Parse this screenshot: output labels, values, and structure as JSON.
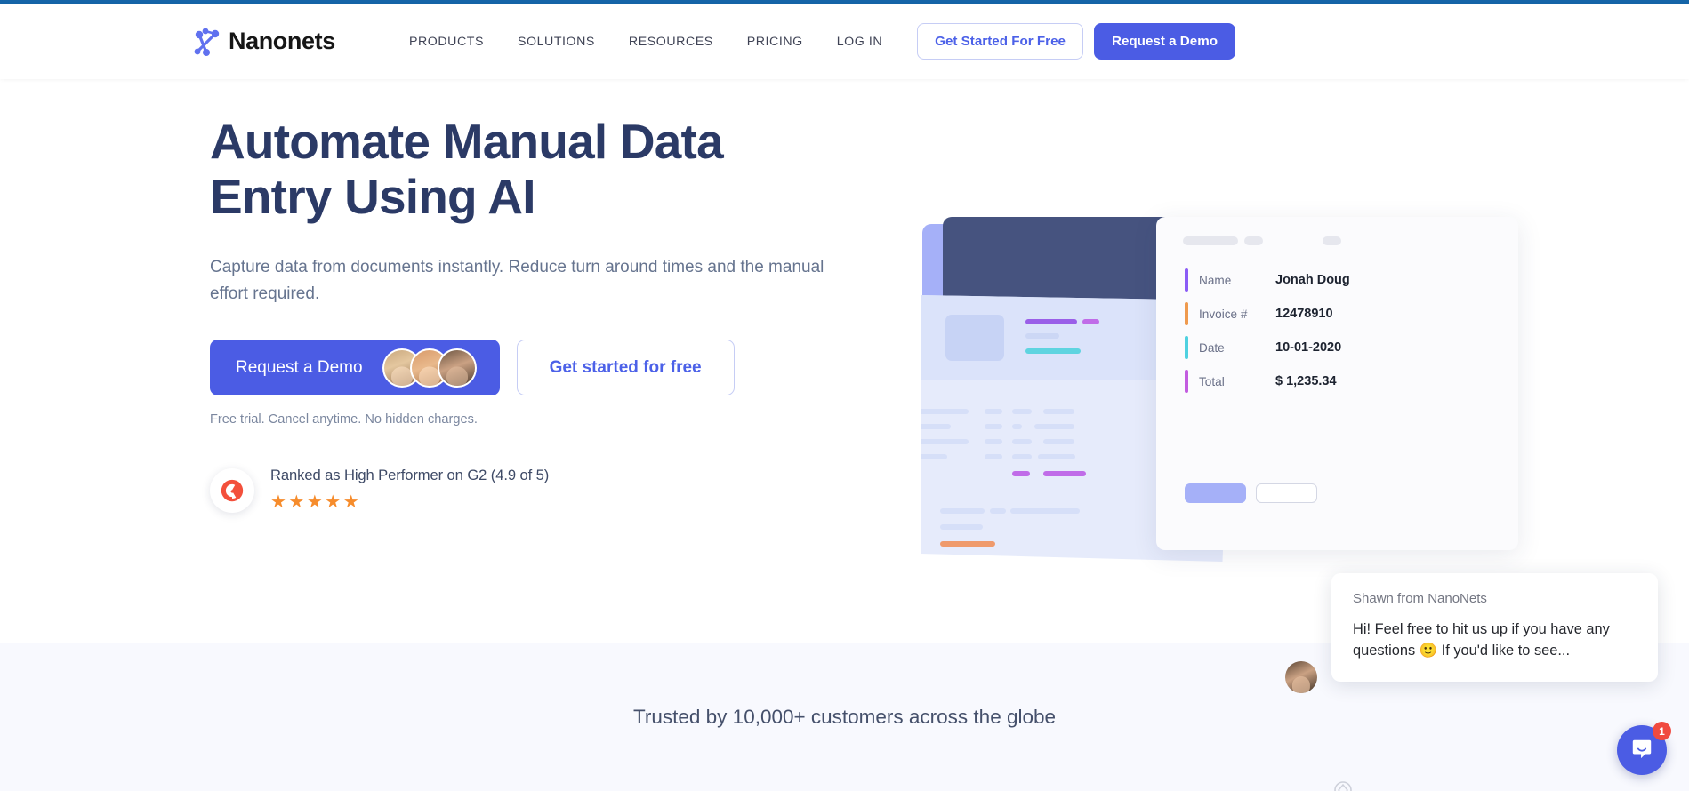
{
  "brand": {
    "name": "Nanonets",
    "logo_icon": "nanonets-logo-icon",
    "accent_blue": "#4b5ce4",
    "accent_light_blue": "#6e84f2",
    "navy": "#2b3a66",
    "star_orange": "#f68c2c"
  },
  "header": {
    "nav_links": [
      {
        "label": "PRODUCTS",
        "name": "nav-products"
      },
      {
        "label": "SOLUTIONS",
        "name": "nav-solutions"
      },
      {
        "label": "RESOURCES",
        "name": "nav-resources"
      },
      {
        "label": "PRICING",
        "name": "nav-pricing"
      },
      {
        "label": "LOG IN",
        "name": "nav-login"
      }
    ],
    "get_started_label": "Get Started For Free",
    "request_demo_label": "Request a Demo"
  },
  "hero": {
    "title_line1": "Automate Manual Data",
    "title_line2": "Entry Using AI",
    "subtitle": "Capture data from documents instantly. Reduce turn around times and the manual effort required.",
    "primary_cta": "Request a Demo",
    "secondary_cta": "Get started for free",
    "trial_note": "Free trial. Cancel anytime. No hidden charges.",
    "avatars": [
      "avatar-customer-1",
      "avatar-customer-2",
      "avatar-customer-3"
    ]
  },
  "g2_badge": {
    "logo_icon": "g2-logo-icon",
    "text": "Ranked as High Performer on G2 (4.9 of 5)",
    "rating": 4.9,
    "rating_max": 5,
    "stars": "★★★★★",
    "star_count": 5
  },
  "illustration": {
    "card_placeholders": [
      "bar-long",
      "bar-short",
      "bar-tiny"
    ],
    "fields": [
      {
        "key": "Name",
        "value": "Jonah Doug",
        "accent": "#8b5cf6"
      },
      {
        "key": "Invoice #",
        "value": "12478910",
        "accent": "#ef9a4e"
      },
      {
        "key": "Date",
        "value": "10-01-2020",
        "accent": "#4fd1e0"
      },
      {
        "key": "Total",
        "value": "$ 1,235.34",
        "accent": "#c35ce0"
      }
    ]
  },
  "trust": {
    "headline": "Trusted by 10,000+ customers across the globe"
  },
  "chat": {
    "from": "Shawn from NanoNets",
    "message": "Hi! Feel free to hit us up if you have any questions 🙂  If you'd like to see...",
    "launcher_icon": "chat-bubble-icon",
    "unread_count": "1"
  }
}
